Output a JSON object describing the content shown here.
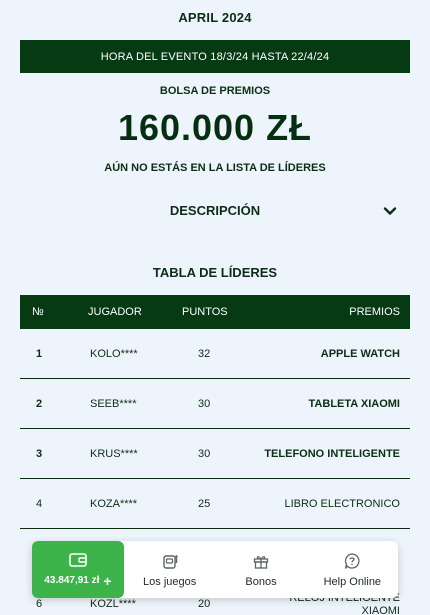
{
  "header": {
    "title": "APRIL 2024",
    "event_time": "HORA DEL EVENTO 18/3/24 HASTA 22/4/24"
  },
  "prize_pool": {
    "label": "BOLSA DE PREMIOS",
    "amount": "160.000 ZŁ",
    "status": "AÚN NO ESTÁS EN LA LISTA DE LÍDERES"
  },
  "description": {
    "label": "DESCRIPCIÓN",
    "icon": "chevron-down-icon"
  },
  "leaderboard": {
    "title": "TABLA DE LÍDERES",
    "columns": [
      "№",
      "JUGADOR",
      "PUNTOS",
      "PREMIOS"
    ],
    "rows": [
      {
        "rank": "1",
        "player": "KOLO****",
        "points": "32",
        "prize": "APPLE WATCH"
      },
      {
        "rank": "2",
        "player": "SEEB****",
        "points": "30",
        "prize": "TABLETA XIAOMI"
      },
      {
        "rank": "3",
        "player": "KRUS****",
        "points": "30",
        "prize": "TELEFONO INTELIGENTE"
      },
      {
        "rank": "4",
        "player": "KOZA****",
        "points": "25",
        "prize": "LIBRO ELECTRONICO"
      },
      {
        "rank": "6",
        "player": "KOZL****",
        "points": "20",
        "prize": "RELOJ INTELIGENTE XIAOMI"
      }
    ]
  },
  "bottom_nav": {
    "wallet_amount": "43.847,91 zł",
    "wallet_plus": "+",
    "items": [
      {
        "label": "Los juegos",
        "icon": "games-icon"
      },
      {
        "label": "Bonos",
        "icon": "gift-icon"
      },
      {
        "label": "Help Online",
        "icon": "help-chat-icon"
      }
    ]
  },
  "colors": {
    "dark_green": "#063a12",
    "accent_green": "#3cb44a",
    "background": "#eef4fb"
  }
}
